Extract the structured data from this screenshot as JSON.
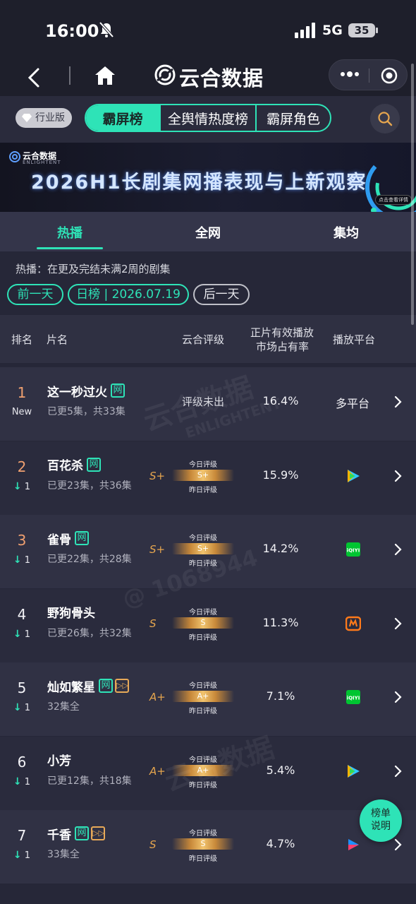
{
  "status_bar": {
    "time": "16:00",
    "network": "5G",
    "battery": "35"
  },
  "nav": {
    "brand": "云合数据"
  },
  "toolbar": {
    "industry_label": "行业版",
    "tabs": [
      "霸屏榜",
      "全舆情热度榜",
      "霸屏角色"
    ]
  },
  "banner": {
    "brand": "云合数据",
    "brand_en": "ENLIGHTENT",
    "title": "2026H1长剧集网播表现与上新观察",
    "button": "点击查看详情"
  },
  "subtabs": [
    "热播",
    "全网",
    "集均"
  ],
  "description": "热播：在更及完结未满2周的剧集",
  "date_nav": {
    "prev": "前一天",
    "current": "日榜 | 2026.07.19",
    "next": "后一天"
  },
  "table_header": {
    "rank": "排名",
    "title": "片名",
    "grade": "云合评级",
    "share_line1": "正片有效播放",
    "share_line2": "市场占有率",
    "platform": "播放平台"
  },
  "grade_labels": {
    "today": "今日评级",
    "yesterday": "昨日评级"
  },
  "rows": [
    {
      "rank": "1",
      "change": "New",
      "title": "这一秒过火",
      "tags": [
        "网"
      ],
      "episodes": "已更5集，共33集",
      "grade_text": "评级未出",
      "share": "16.4%",
      "platform": "多平台"
    },
    {
      "rank": "2",
      "change": "1",
      "title": "百花杀",
      "tags": [
        "网"
      ],
      "episodes": "已更23集，共36集",
      "grade_letter": "S+",
      "grade_today": "S+",
      "share": "15.9%",
      "platform_icon": "tencent-video-icon"
    },
    {
      "rank": "3",
      "change": "1",
      "title": "雀骨",
      "tags": [
        "网"
      ],
      "episodes": "已更22集，共28集",
      "grade_letter": "S+",
      "grade_today": "S+",
      "share": "14.2%",
      "platform_icon": "iqiyi-icon"
    },
    {
      "rank": "4",
      "change": "1",
      "title": "野狗骨头",
      "tags": [],
      "episodes": "已更26集，共32集",
      "grade_letter": "S",
      "grade_today": "S",
      "share": "11.3%",
      "platform_icon": "mgtv-icon"
    },
    {
      "rank": "5",
      "change": "1",
      "title": "灿如繁星",
      "tags": [
        "网",
        "▷▷"
      ],
      "episodes": "32集全",
      "grade_letter": "A+",
      "grade_today": "A+",
      "share": "7.1%",
      "platform_icon": "iqiyi-icon"
    },
    {
      "rank": "6",
      "change": "1",
      "title": "小芳",
      "tags": [],
      "episodes": "已更12集，共18集",
      "grade_letter": "A+",
      "grade_today": "A+",
      "share": "5.4%",
      "platform_icon": "tencent-video-icon"
    },
    {
      "rank": "7",
      "change": "1",
      "title": "千香",
      "tags": [
        "网",
        "▷▷"
      ],
      "episodes": "33集全",
      "grade_letter": "S",
      "grade_today": "S",
      "share": "4.7%",
      "platform_icon": "youku-icon"
    }
  ],
  "float_button": {
    "line1": "榜单",
    "line2": "说明"
  },
  "watermark": {
    "brand": "云合数据",
    "brand_en": "ENLIGHTENT",
    "id": "@ 1068944"
  },
  "colors": {
    "accent": "#2ee3b7",
    "grade_gold": "#e6a64e",
    "background": "#262738"
  }
}
